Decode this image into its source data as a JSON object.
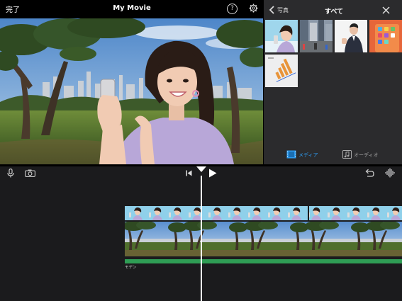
{
  "header": {
    "done_label": "完了",
    "project_title": "My Movie",
    "help_symbol": "?"
  },
  "media_browser": {
    "back_label": "写真",
    "category_title": "すべて",
    "segment_media_label": "メディア",
    "segment_audio_label": "オーディオ",
    "active_color": "#2d9bf0"
  },
  "timeline": {
    "audio_track_label": "モデン",
    "audio_color": "#2f9d55"
  }
}
